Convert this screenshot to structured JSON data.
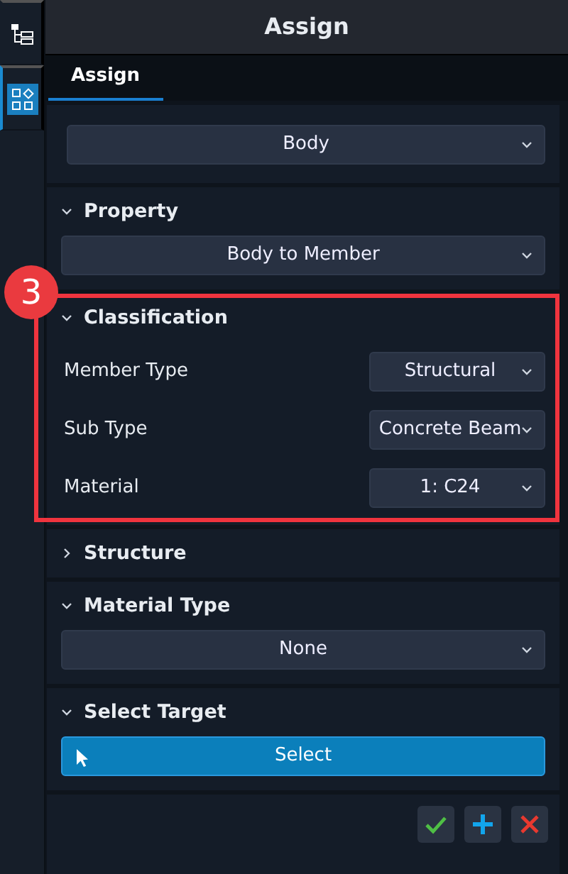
{
  "sidebar": {
    "items": [
      {
        "kind": "tree",
        "selected": false
      },
      {
        "kind": "grid",
        "selected": true
      }
    ]
  },
  "header": {
    "title": "Assign"
  },
  "tabs": [
    {
      "label": "Assign",
      "selected": true
    }
  ],
  "sections": [
    {
      "kind": "select",
      "value": "Body"
    },
    {
      "kind": "group",
      "title": "Property",
      "expanded": true,
      "content": {
        "kind": "select",
        "value": "Body to Member"
      }
    },
    {
      "kind": "group",
      "title": "Classification",
      "expanded": true,
      "callout": "3",
      "content": {
        "kind": "fields",
        "fields": [
          {
            "label": "Member Type",
            "value": "Structural"
          },
          {
            "label": "Sub Type",
            "value": "Concrete Beam"
          },
          {
            "label": "Material",
            "value": "1: C24"
          }
        ]
      }
    },
    {
      "kind": "group",
      "title": "Structure",
      "expanded": false
    },
    {
      "kind": "group",
      "title": "Material Type",
      "expanded": true,
      "content": {
        "kind": "select",
        "value": "None"
      }
    },
    {
      "kind": "group",
      "title": "Select Target",
      "expanded": true,
      "content": {
        "kind": "button",
        "label": "Select"
      }
    }
  ],
  "footer": {
    "buttons": [
      {
        "kind": "confirm"
      },
      {
        "kind": "add"
      },
      {
        "kind": "cancel"
      }
    ]
  }
}
